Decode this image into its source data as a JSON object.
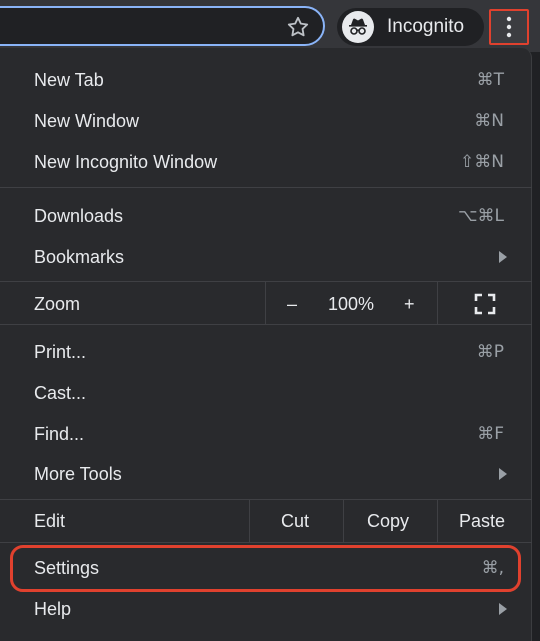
{
  "toolbar": {
    "incognito_label": "Incognito",
    "star_icon": "star-icon",
    "incognito_icon": "incognito-icon",
    "menu_icon": "more-vert-icon"
  },
  "menu": {
    "new_tab": {
      "label": "New Tab",
      "shortcut": "⌘T"
    },
    "new_window": {
      "label": "New Window",
      "shortcut": "⌘N"
    },
    "new_incognito": {
      "label": "New Incognito Window",
      "shortcut": "⇧⌘N"
    },
    "downloads": {
      "label": "Downloads",
      "shortcut": "⌥⌘L"
    },
    "bookmarks": {
      "label": "Bookmarks"
    },
    "zoom": {
      "label": "Zoom",
      "minus": "–",
      "value": "100%",
      "plus": "+"
    },
    "print": {
      "label": "Print...",
      "shortcut": "⌘P"
    },
    "cast": {
      "label": "Cast..."
    },
    "find": {
      "label": "Find...",
      "shortcut": "⌘F"
    },
    "more_tools": {
      "label": "More Tools"
    },
    "edit": {
      "label": "Edit",
      "cut": "Cut",
      "copy": "Copy",
      "paste": "Paste"
    },
    "settings": {
      "label": "Settings",
      "shortcut": "⌘,"
    },
    "help": {
      "label": "Help"
    }
  },
  "colors": {
    "menu_bg": "#292a2d",
    "highlight": "#e0412e",
    "focus_ring": "#8ab4f8"
  }
}
